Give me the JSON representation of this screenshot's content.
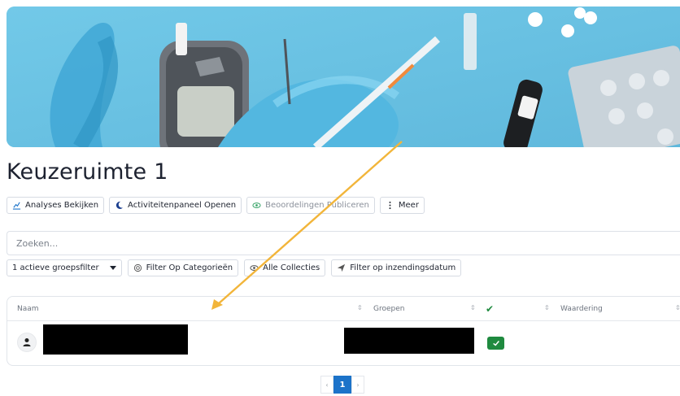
{
  "banner": {
    "image": "diabetes-medical-supplies-banner"
  },
  "page": {
    "title": "Keuzeruimte 1"
  },
  "actions": [
    {
      "label": "Analyses Bekijken",
      "icon": "chart-icon"
    },
    {
      "label": "Activiteitenpaneel Openen",
      "icon": "moon-icon"
    },
    {
      "label": "Beoordelingen Publiceren",
      "icon": "eye-icon"
    },
    {
      "label": "Meer",
      "icon": "vertical-dots-icon"
    }
  ],
  "search": {
    "placeholder": "Zoeken..."
  },
  "filters": {
    "group_filter": "1 actieve groepsfilter",
    "category": "Filter Op Categorieën",
    "collections": "Alle Collecties",
    "submission_date": "Filter op inzendingsdatum"
  },
  "table": {
    "columns": {
      "name": "Naam",
      "groups": "Groepen",
      "status": "✔",
      "rating": "Waardering"
    },
    "rows": [
      {
        "name": "",
        "groups": "",
        "status": "checked",
        "rating": ""
      }
    ]
  },
  "pagination": {
    "prev": "‹",
    "current": "1",
    "next": "›"
  },
  "colors": {
    "accent": "#1c73c9",
    "success": "#1f8a3f",
    "annotation": "#f2b53a",
    "banner_bg": "#6cc6e6"
  }
}
